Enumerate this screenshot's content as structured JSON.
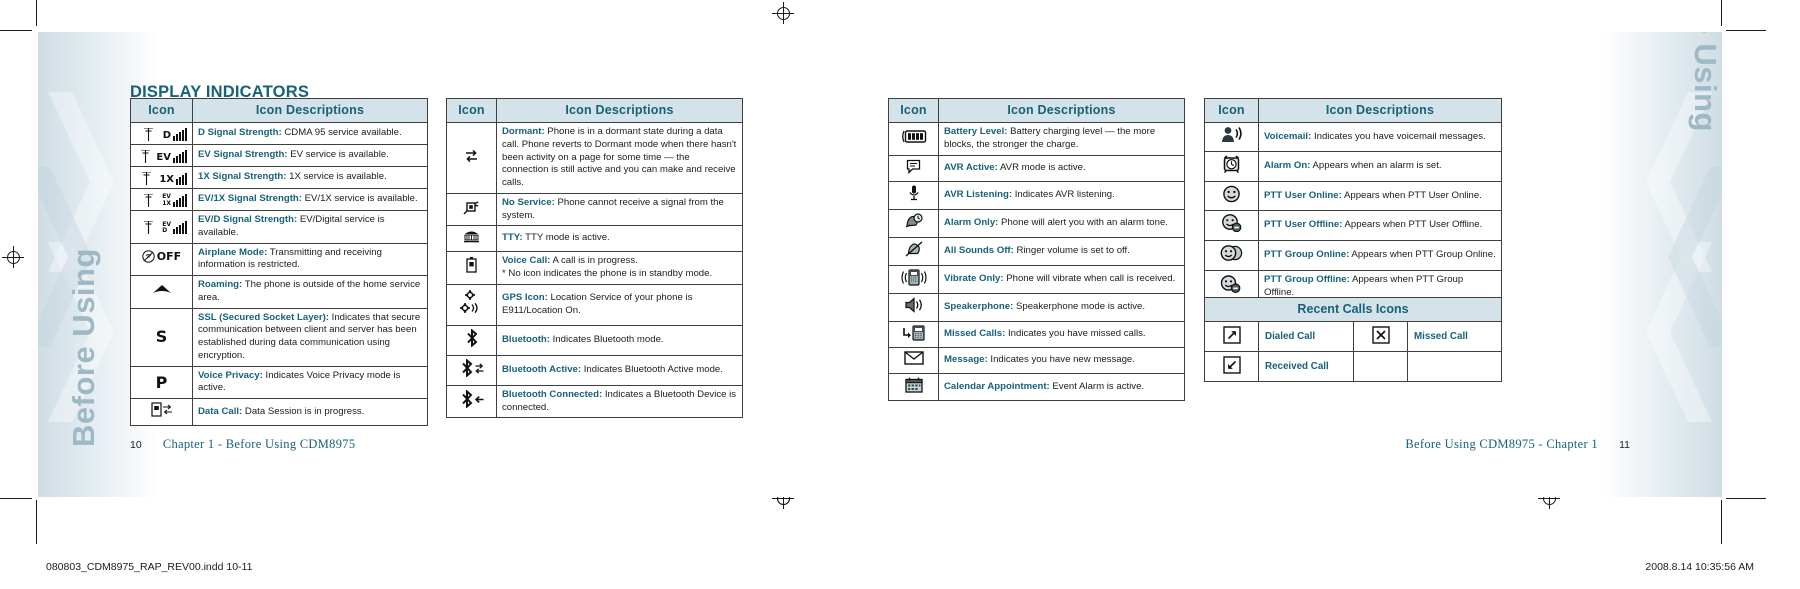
{
  "spread": {
    "section_title": "DISPLAY INDICATORS",
    "watermark_left": "Before Using",
    "watermark_right": "Before Using"
  },
  "table_headers": {
    "icon": "Icon",
    "description": "Icon Descriptions"
  },
  "table1": {
    "rows": [
      {
        "icon": "signal-d-icon",
        "term": "D Signal Strength:",
        "text": " CDMA 95 service available."
      },
      {
        "icon": "signal-ev-icon",
        "term": "EV Signal Strength:",
        "text": "  EV service is available."
      },
      {
        "icon": "signal-1x-icon",
        "term": "1X Signal Strength:",
        "text": "  1X service is available."
      },
      {
        "icon": "signal-ev1x-icon",
        "term": "EV/1X Signal Strength:",
        "text": "  EV/1X service is available."
      },
      {
        "icon": "signal-evd-icon",
        "term": "EV/D Signal Strength:",
        "text": "  EV/Digital service is available."
      },
      {
        "icon": "airplane-mode-icon",
        "term": "Airplane Mode:",
        "text": " Transmitting and receiving information is restricted."
      },
      {
        "icon": "roaming-icon",
        "term": "Roaming:",
        "text": " The phone is outside of the home service area."
      },
      {
        "icon": "ssl-icon",
        "term": "SSL (Secured Socket Layer):",
        "text": " Indicates that secure communication between client and server has been established during data communication using encryption."
      },
      {
        "icon": "voice-privacy-icon",
        "term": "Voice Privacy:",
        "text": " Indicates Voice Privacy mode is active."
      },
      {
        "icon": "data-call-icon",
        "term": "Data Call:",
        "text": " Data Session is in progress."
      }
    ]
  },
  "table2": {
    "rows": [
      {
        "icon": "dormant-icon",
        "term": "Dormant:",
        "text": " Phone is in a dormant state during a data call. Phone reverts to Dormant mode when there hasn't been activity on a page for some time — the connection is still active and you can make and receive calls."
      },
      {
        "icon": "no-service-icon",
        "term": "No Service:",
        "text": " Phone cannot receive a signal from the system."
      },
      {
        "icon": "tty-icon",
        "term": "TTY:",
        "text": " TTY mode is active."
      },
      {
        "icon": "voice-call-icon",
        "term": "Voice Call:",
        "text": " A call is in progress.",
        "text2": "* No icon indicates the phone is in standby mode."
      },
      {
        "icon": "gps-icon",
        "term": "GPS Icon:",
        "text": " Location Service of your phone is E911/Location On."
      },
      {
        "icon": "bluetooth-icon",
        "term": "Bluetooth:",
        "text": " Indicates Bluetooth mode."
      },
      {
        "icon": "bluetooth-active-icon",
        "term": "Bluetooth Active:",
        "text": " Indicates Bluetooth Active mode."
      },
      {
        "icon": "bluetooth-connected-icon",
        "term": "Bluetooth Connected:",
        "text": " Indicates a Bluetooth Device is connected."
      }
    ]
  },
  "table3": {
    "rows": [
      {
        "icon": "battery-level-icon",
        "term": "Battery Level:",
        "text": " Battery charging level — the more blocks, the stronger the charge."
      },
      {
        "icon": "avr-active-icon",
        "term": "AVR Active:",
        "text": " AVR mode is active."
      },
      {
        "icon": "avr-listening-icon",
        "term": "AVR Listening:",
        "text": " Indicates AVR listening."
      },
      {
        "icon": "alarm-only-icon",
        "term": "Alarm Only:",
        "text": " Phone will alert you with an alarm tone."
      },
      {
        "icon": "all-sounds-off-icon",
        "term": "All Sounds Off:",
        "text": " Ringer volume is set to off."
      },
      {
        "icon": "vibrate-only-icon",
        "term": "Vibrate Only:",
        "text": " Phone will vibrate when call is received."
      },
      {
        "icon": "speakerphone-icon",
        "term": "Speakerphone:",
        "text": " Speakerphone mode is active."
      },
      {
        "icon": "missed-calls-icon",
        "term": "Missed Calls:",
        "text": " Indicates you have missed calls."
      },
      {
        "icon": "message-icon",
        "term": "Message:",
        "text": " Indicates you have new message."
      },
      {
        "icon": "calendar-appointment-icon",
        "term": "Calendar Appointment:",
        "text": " Event Alarm is active."
      }
    ]
  },
  "table4": {
    "rows": [
      {
        "icon": "voicemail-icon",
        "term": "Voicemail:",
        "text": " Indicates you have voicemail messages."
      },
      {
        "icon": "alarm-on-icon",
        "term": "Alarm On:",
        "text": " Appears when an alarm is set."
      },
      {
        "icon": "ptt-user-online-icon",
        "term": "PTT User Online:",
        "text": " Appears when PTT User Online."
      },
      {
        "icon": "ptt-user-offline-icon",
        "term": "PTT User Offline:",
        "text": " Appears when PTT User Offline."
      },
      {
        "icon": "ptt-group-online-icon",
        "term": "PTT Group Online:",
        "text": " Appears when PTT Group Online."
      },
      {
        "icon": "ptt-group-offline-icon",
        "term": "PTT Group Offline:",
        "text": " Appears when PTT Group Offline."
      }
    ]
  },
  "recent_calls": {
    "title": "Recent Calls Icons",
    "cells": [
      {
        "icon": "dialed-call-icon",
        "label": "Dialed Call"
      },
      {
        "icon": "missed-call-icon",
        "label": "Missed Call"
      },
      {
        "icon": "received-call-icon",
        "label": "Received Call"
      },
      {
        "icon": "",
        "label": ""
      }
    ]
  },
  "footer": {
    "left_page_number": "10",
    "left_chapter": "Chapter 1 - Before Using CDM8975",
    "right_chapter": "Before Using CDM8975 - Chapter 1",
    "right_page_number": "11",
    "slug_file": "080803_CDM8975_RAP_REV00.indd   10-11",
    "slug_date": "2008.8.14   10:35:56 AM"
  },
  "colors": {
    "heading_teal": "#176179",
    "header_fill": "#d4e3ea",
    "border": "#3f3f3f",
    "watermark": "#9db9c6"
  }
}
